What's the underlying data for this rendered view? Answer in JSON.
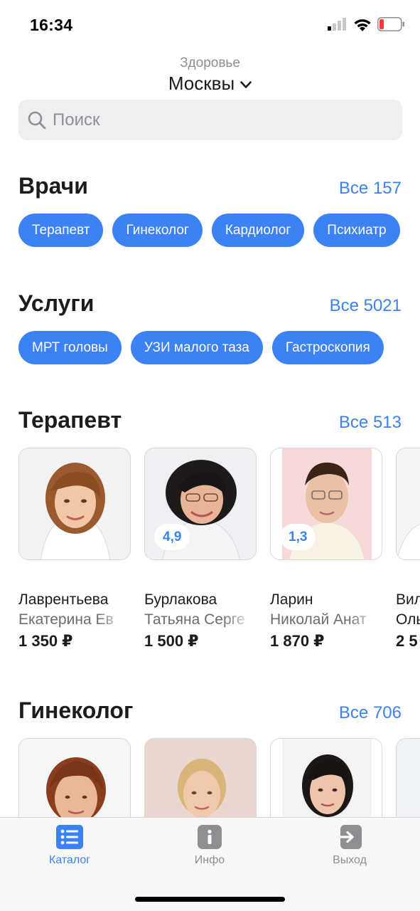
{
  "status_bar": {
    "time": "16:34"
  },
  "location": {
    "subtitle": "Здоровье",
    "city": "Москвы"
  },
  "search": {
    "placeholder": "Поиск"
  },
  "doctors_section": {
    "title": "Врачи",
    "all_link": "Все 157",
    "chips": [
      "Терапевт",
      "Гинеколог",
      "Кардиолог",
      "Психиатр"
    ]
  },
  "services_section": {
    "title": "Услуги",
    "all_link": "Все 5021",
    "chips": [
      "МРТ головы",
      "УЗИ малого таза",
      "Гастроскопия"
    ]
  },
  "therapist_section": {
    "title": "Терапевт",
    "all_link": "Все 513",
    "doctors": [
      {
        "last_name": "Лаврентьева",
        "first_names": "Екатерина Ев",
        "price": "1 350 ₽",
        "rating": ""
      },
      {
        "last_name": "Бурлакова",
        "first_names": "Татьяна Серге",
        "price": "1 500 ₽",
        "rating": "4,9"
      },
      {
        "last_name": "Ларин",
        "first_names": "Николай Анат",
        "price": "1 870 ₽",
        "rating": "1,3"
      },
      {
        "last_name": "Вил",
        "first_names": "Оль",
        "price": "2 5",
        "rating": ""
      }
    ]
  },
  "gynecologist_section": {
    "title": "Гинеколог",
    "all_link": "Все 706"
  },
  "tab_bar": {
    "tabs": [
      {
        "label": "Каталог",
        "icon": "list-icon",
        "active": true
      },
      {
        "label": "Инфо",
        "icon": "info-icon",
        "active": false
      },
      {
        "label": "Выход",
        "icon": "logout-icon",
        "active": false
      }
    ]
  },
  "colors": {
    "accent": "#3d82f4",
    "link": "#3b82f6",
    "muted": "#8e8e93"
  }
}
